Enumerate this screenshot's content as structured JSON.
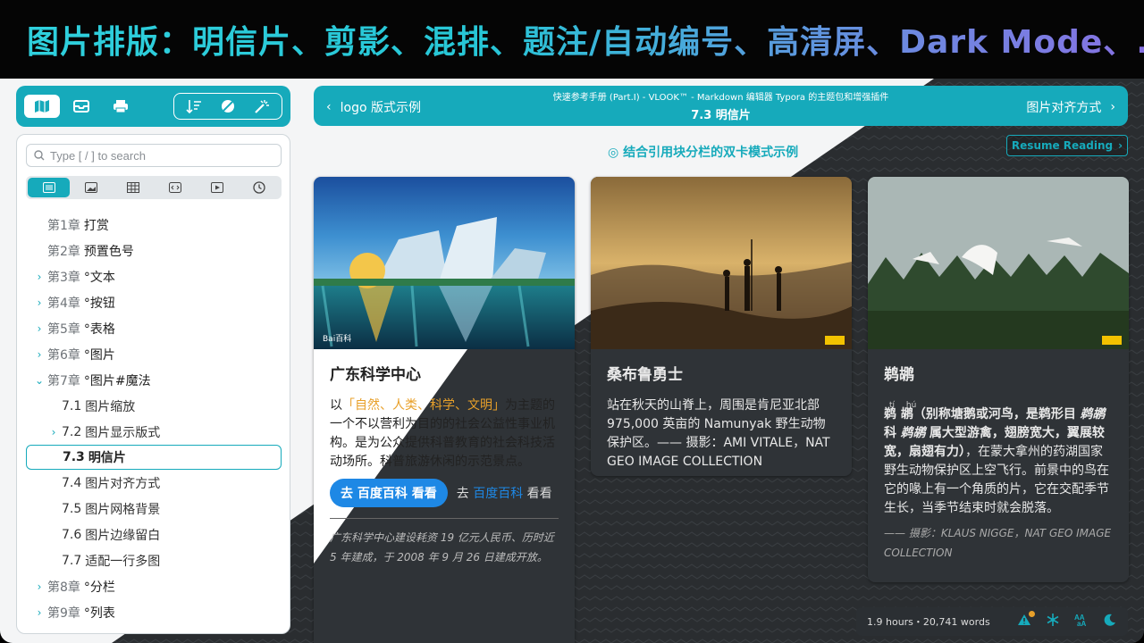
{
  "banner": {
    "title": "图片排版：明信片、剪影、混排、题注/自动编号、高清屏、Dark Mode、..."
  },
  "toolbar": {
    "left_icons": [
      "map-icon",
      "inbox-icon",
      "printer-icon"
    ],
    "right_icons": [
      "sort-icon",
      "shapes-icon",
      "magic-wand-icon"
    ]
  },
  "sidebar": {
    "search": {
      "placeholder": "Type [ / ] to search"
    },
    "filters": [
      "list-icon",
      "image-icon",
      "table-icon",
      "code-icon",
      "video-icon",
      "clock-icon"
    ],
    "items": [
      {
        "chapter": "第1章",
        "title": "打赏",
        "level": 1,
        "chevron": ""
      },
      {
        "chapter": "第2章",
        "title": "预置色号",
        "level": 1,
        "chevron": ""
      },
      {
        "chapter": "第3章",
        "title": "°文本",
        "level": 1,
        "chevron": "›"
      },
      {
        "chapter": "第4章",
        "title": "°按钮",
        "level": 1,
        "chevron": "›"
      },
      {
        "chapter": "第5章",
        "title": "°表格",
        "level": 1,
        "chevron": "›"
      },
      {
        "chapter": "第6章",
        "title": "°图片",
        "level": 1,
        "chevron": "›"
      },
      {
        "chapter": "第7章",
        "title": "°图片#魔法",
        "level": 1,
        "chevron": "⌄"
      },
      {
        "chapter": "7.1",
        "title": "图片缩放",
        "level": 2,
        "chevron": ""
      },
      {
        "chapter": "7.2",
        "title": "图片显示版式",
        "level": 2,
        "chevron": "›"
      },
      {
        "chapter": "7.3",
        "title": "明信片",
        "level": 2,
        "chevron": "",
        "active": true
      },
      {
        "chapter": "7.4",
        "title": "图片对齐方式",
        "level": 2,
        "chevron": ""
      },
      {
        "chapter": "7.5",
        "title": "图片网格背景",
        "level": 2,
        "chevron": ""
      },
      {
        "chapter": "7.6",
        "title": "图片边缘留白",
        "level": 2,
        "chevron": ""
      },
      {
        "chapter": "7.7",
        "title": "适配一行多图",
        "level": 2,
        "chevron": ""
      },
      {
        "chapter": "第8章",
        "title": "°分栏",
        "level": 1,
        "chevron": "›"
      },
      {
        "chapter": "第9章",
        "title": "°列表",
        "level": 1,
        "chevron": "›"
      }
    ]
  },
  "nav": {
    "prev_label": "logo 版式示例",
    "next_label": "图片对齐方式",
    "subtitle": "快速参考手册 (Part.I) - VLOOK™ - Markdown 编辑器 Typora 的主题包和增强插件",
    "current": "7.3 明信片"
  },
  "resume": {
    "label": "Resume Reading"
  },
  "caption": {
    "text": "◎ 结合引用块分栏的双卡模式示例"
  },
  "cards": [
    {
      "title": "广东科学中心",
      "watermark": "Bai百科",
      "text_pre": "以",
      "text_hl": "「自然、人类、科学、文明」",
      "text_post": "为主题的一个不以营利为目的的社会公益性事业机构。是为公众提供科普教育的社会科技活动场所。科普旅游休闲的示范景点。",
      "button": "去 百度百科 看看",
      "link_pre": "去",
      "link": "百度百科",
      "link_post": "看看",
      "note": "广东科学中心建设耗资 19 亿元人民币、历时近 5 年建成，于 2008 年 9 月 26 日建成开放。"
    },
    {
      "title": "桑布鲁勇士",
      "text": "站在秋天的山脊上，周围是肯尼亚北部 975,000 英亩的 Namunyak 野生动物保护区。—— 摄影：AMI VITALE，NAT GEO IMAGE COLLECTION"
    },
    {
      "title": "鹈鹕",
      "ruby_ti": "tí",
      "ruby_hu": "hú",
      "text_a": "鹈 鹕",
      "text_b": "（别称塘鹅或河鸟，是鹈形目",
      "text_c": "鹈鹕",
      "text_d": "科",
      "text_e": "鹈鹕",
      "text_f": "属大型游禽，翅膀宽大，翼展较宽，扇翅有力）",
      "text_g": "，在蒙大拿州的药湖国家野生动物保护区上空飞行。前景中的鸟在它的喙上有一个角质的片，它在交配季节生长，当季节结束时就会脱落。",
      "note": "—— 摄影：KLAUS NIGGE，NAT GEO IMAGE COLLECTION"
    }
  ],
  "status": {
    "stats": "1.9 hours・20,741 words",
    "icons": [
      "warning-icon",
      "snowflake-icon",
      "font-size-icon",
      "moon-icon"
    ]
  },
  "colors": {
    "accent": "#16aabb",
    "highlight": "#e8a02a",
    "link": "#1e88e5"
  }
}
